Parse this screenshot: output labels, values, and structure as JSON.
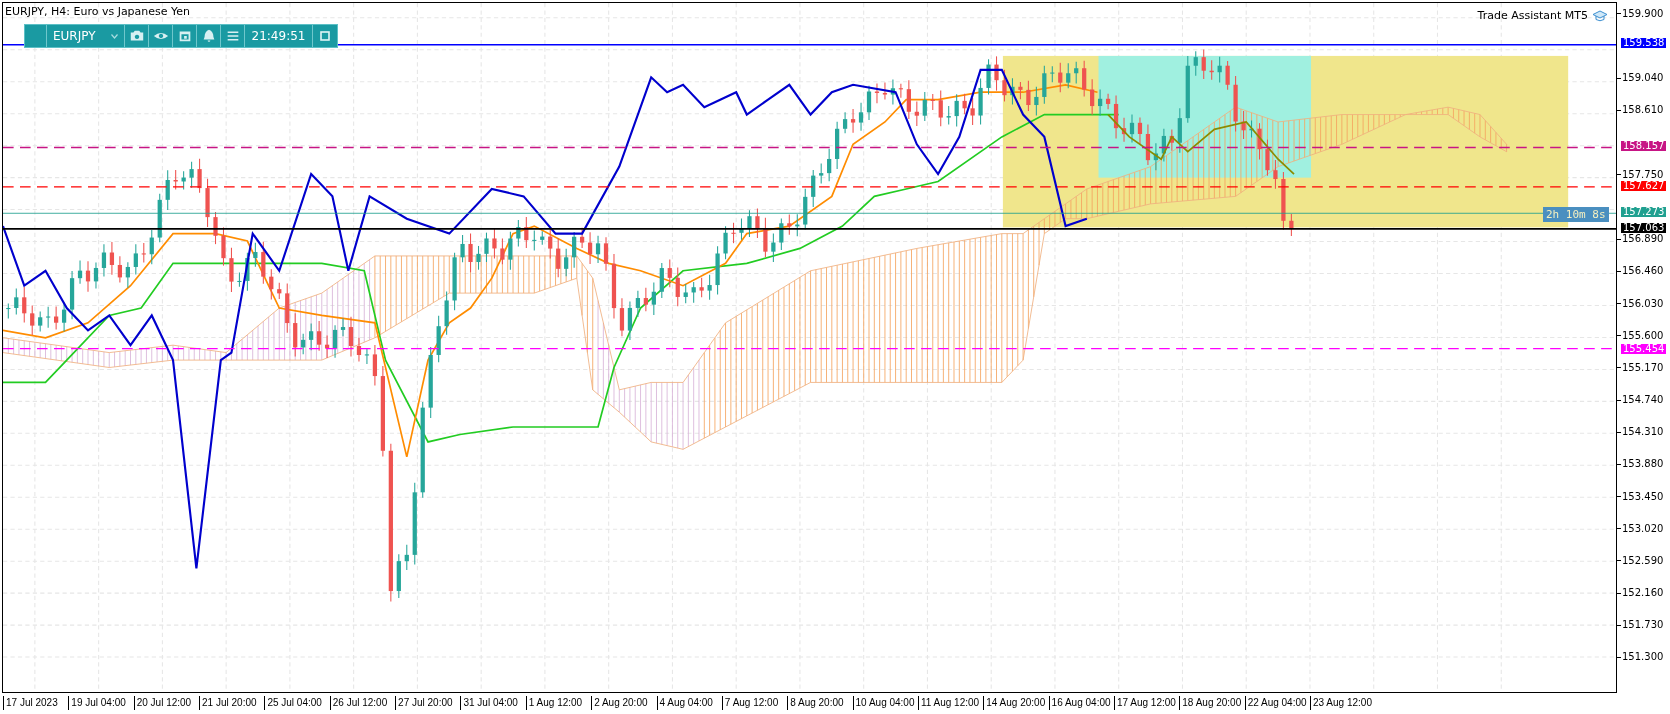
{
  "chart_title": "EURJPY, H4:  Euro vs Japanese Yen",
  "toolbar": {
    "symbol": "EURJPY",
    "clock": "21:49:51"
  },
  "indicator_label": "Trade Assistant MT5",
  "countdown": "2h 10m 8s",
  "price_axis": {
    "ticks": [
      "159.900",
      "159.040",
      "158.610",
      "157.750",
      "156.890",
      "156.460",
      "156.030",
      "155.600",
      "155.170",
      "154.740",
      "154.310",
      "153.880",
      "153.450",
      "153.020",
      "152.590",
      "152.160",
      "151.730",
      "151.300"
    ]
  },
  "price_levels": [
    {
      "price": "159.538",
      "color": "#0000ff",
      "kind": "solid"
    },
    {
      "price": "158.157",
      "color": "#c71585",
      "kind": "dashed"
    },
    {
      "price": "157.627",
      "color": "#ff0000",
      "kind": "dashed"
    },
    {
      "price": "157.273",
      "color": "#20a090",
      "kind": "thin"
    },
    {
      "price": "157.063",
      "color": "#000000",
      "kind": "solid"
    },
    {
      "price": "155.454",
      "color": "#ff00ff",
      "kind": "dashed"
    }
  ],
  "time_axis": {
    "labels": [
      "17 Jul 2023",
      "19 Jul 04:00",
      "20 Jul 12:00",
      "21 Jul 20:00",
      "25 Jul 04:00",
      "26 Jul 12:00",
      "27 Jul 20:00",
      "31 Jul 04:00",
      "1 Aug 12:00",
      "2 Aug 20:00",
      "4 Aug 04:00",
      "7 Aug 12:00",
      "8 Aug 20:00",
      "10 Aug 04:00",
      "11 Aug 12:00",
      "14 Aug 20:00",
      "16 Aug 04:00",
      "17 Aug 12:00",
      "18 Aug 20:00",
      "22 Aug 04:00",
      "23 Aug 12:00"
    ]
  }
}
